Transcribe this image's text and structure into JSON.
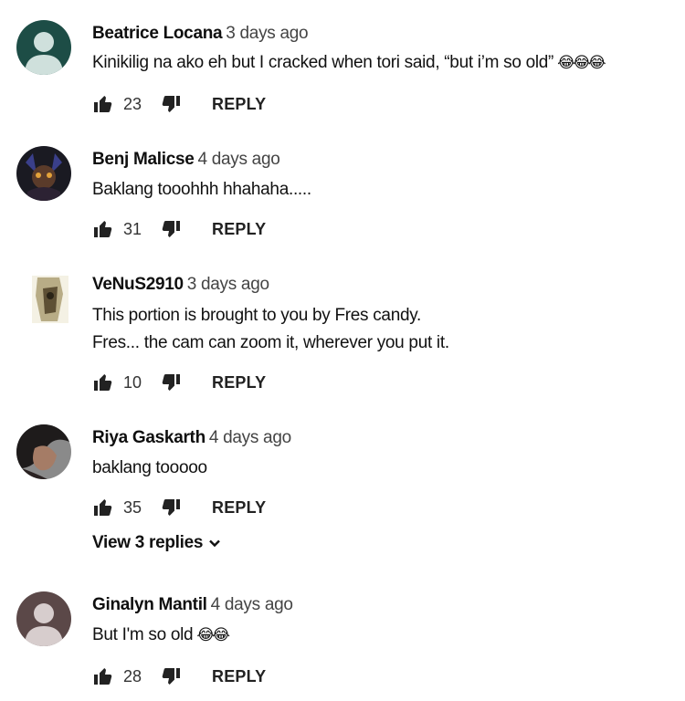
{
  "comments": [
    {
      "author": "Beatrice Locana",
      "time": "3 days ago",
      "lines": [
        "Kinikilig na ako eh but I cracked when tori said, “but i’m so old”"
      ],
      "emoji": "😂😂😂",
      "likes": "23",
      "reply": "REPLY",
      "avatar_icon": "default-avatar-teal",
      "avatar_color": "#1d4d46"
    },
    {
      "author": "Benj Malicse",
      "time": "4 days ago",
      "lines": [
        "Baklang tooohhh hhahaha....."
      ],
      "emoji": "",
      "likes": "31",
      "reply": "REPLY",
      "avatar_icon": "photo-avatar-dark"
    },
    {
      "author": "VeNuS2910",
      "time": "3 days ago",
      "lines": [
        "This portion is brought to you by Fres candy.",
        "Fres... the cam can zoom it, wherever you put it."
      ],
      "emoji": "",
      "likes": "10",
      "reply": "REPLY",
      "avatar_icon": "photo-avatar-small"
    },
    {
      "author": "Riya Gaskarth",
      "time": "4 days ago",
      "lines": [
        "baklang tooooo"
      ],
      "emoji": "",
      "likes": "35",
      "reply": "REPLY",
      "avatar_icon": "photo-avatar-face",
      "view_replies": "View 3 replies"
    },
    {
      "author": "Ginalyn Mantil",
      "time": "4 days ago",
      "lines": [
        "But I'm so old"
      ],
      "emoji": "😂😂",
      "likes": "28",
      "reply": "REPLY",
      "avatar_icon": "default-avatar-brown",
      "avatar_color": "#5b4848"
    }
  ]
}
